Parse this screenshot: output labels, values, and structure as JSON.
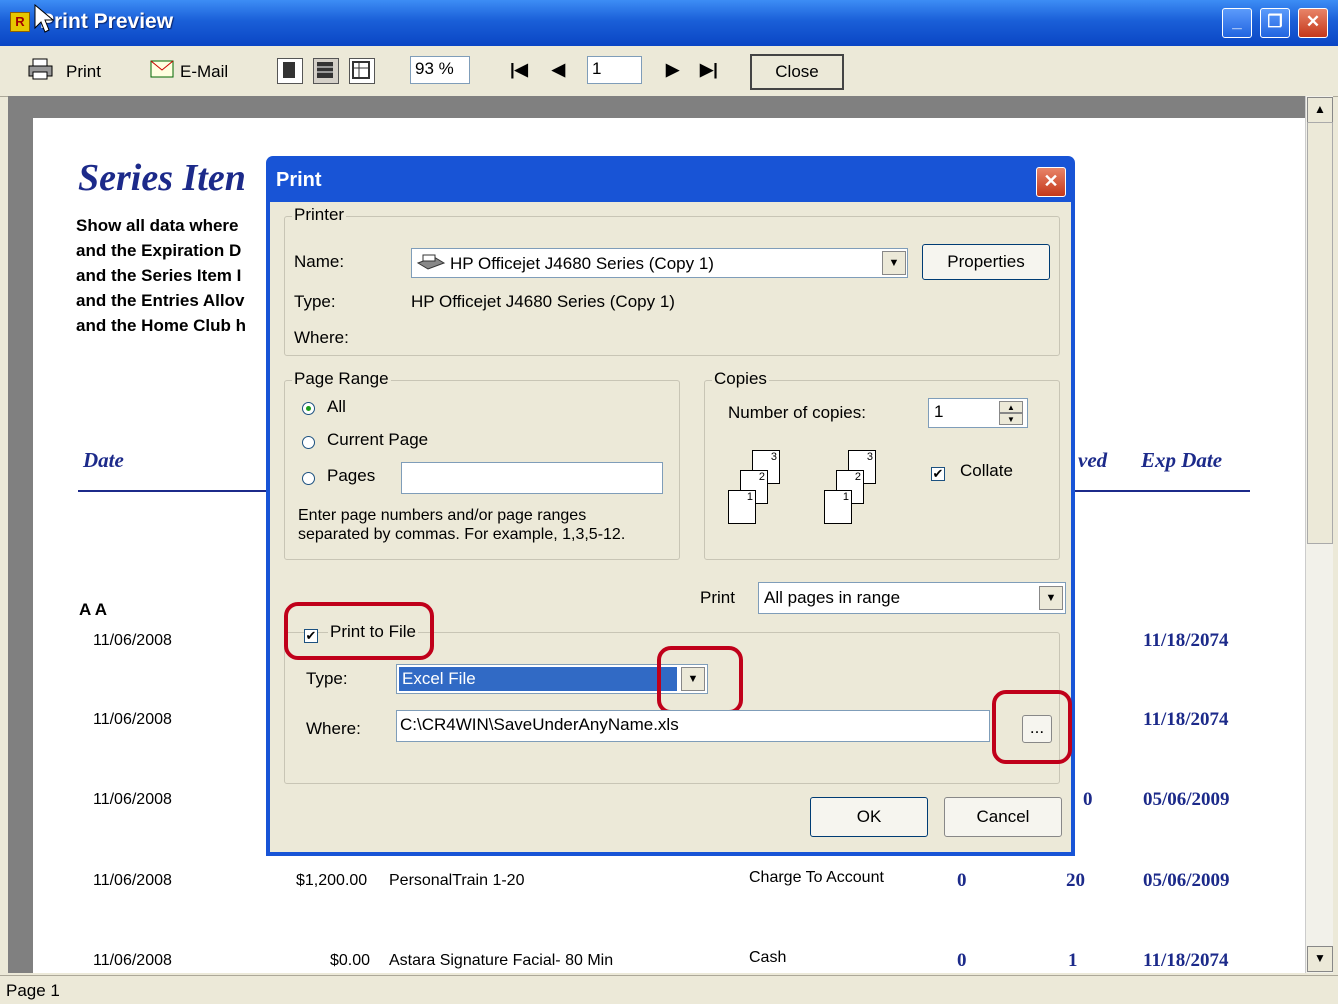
{
  "window": {
    "title": "Print Preview",
    "app_icon_letter": "R",
    "minimize": "_",
    "restore": "❐",
    "close": "✕"
  },
  "toolbar": {
    "print_label": "Print",
    "email_label": "E-Mail",
    "zoom": "93 %",
    "page_number": "1",
    "close_label": "Close"
  },
  "report": {
    "title": "Series Iten",
    "criteria": [
      "Show all data where",
      "and the Expiration D",
      "and the Series Item I",
      "and the Entries Allov",
      "and the Home Club h"
    ],
    "col_date": "Date",
    "col_used_partial": "ved",
    "col_exp": "Exp Date",
    "group": "A A",
    "rows": [
      {
        "date": "11/06/2008",
        "amount": "",
        "item": "",
        "payment": "",
        "c1": "",
        "c2": "",
        "exp": "11/18/2074"
      },
      {
        "date": "11/06/2008",
        "amount": "",
        "item": "",
        "payment": "",
        "c1": "",
        "c2": "",
        "exp": "11/18/2074"
      },
      {
        "date": "11/06/2008",
        "amount": "",
        "item": "",
        "payment": "",
        "c1": "",
        "c2": "0",
        "exp": "05/06/2009"
      },
      {
        "date": "11/06/2008",
        "amount": "$1,200.00",
        "item": "PersonalTrain 1-20",
        "payment": "Charge To Account",
        "c1": "0",
        "c2": "20",
        "exp": "05/06/2009"
      },
      {
        "date": "11/06/2008",
        "amount": "$0.00",
        "item": "Astara Signature Facial- 80 Min",
        "payment": "Cash",
        "c1": "0",
        "c2": "1",
        "exp": "11/18/2074"
      }
    ]
  },
  "status": {
    "page": "Page 1"
  },
  "dialog": {
    "title": "Print",
    "close": "✕",
    "printer_group": "Printer",
    "name_label": "Name:",
    "printer_name": "HP Officejet J4680 Series (Copy 1)",
    "properties_label": "Properties",
    "type_label": "Type:",
    "type_value": "HP Officejet J4680 Series (Copy 1)",
    "where_label": "Where:",
    "page_range_group": "Page Range",
    "all_label": "All",
    "current_page_label": "Current Page",
    "pages_label": "Pages",
    "pages_hint_1": "Enter page numbers and/or page ranges",
    "pages_hint_2": "separated by commas.  For example, 1,3,5-12.",
    "copies_group": "Copies",
    "num_copies_label": "Number of copies:",
    "num_copies": "1",
    "collate_label": "Collate",
    "print_label": "Print",
    "print_option": "All pages in range",
    "print_to_file_label": "Print to File",
    "file_type_label": "Type:",
    "file_type": "Excel File",
    "file_where_label": "Where:",
    "file_path": "C:\\CR4WIN\\SaveUnderAnyName.xls",
    "browse_label": "...",
    "ok_label": "OK",
    "cancel_label": "Cancel"
  },
  "colors": {
    "title_blue": "#1854d6",
    "report_blue": "#1c2a8a",
    "highlight": "#c0001a"
  }
}
